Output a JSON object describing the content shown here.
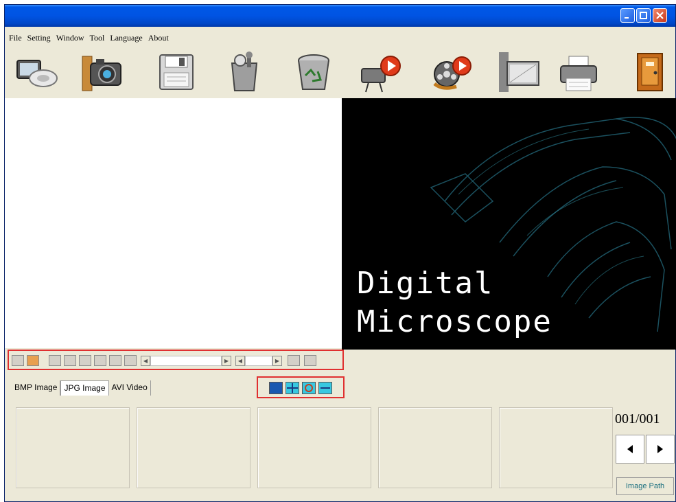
{
  "window": {
    "title": "",
    "controls": {
      "minimize": "minimize-icon",
      "maximize": "maximize-icon",
      "close": "close-icon"
    }
  },
  "menu": {
    "items": [
      "File",
      "Setting",
      "Window",
      "Tool",
      "Language",
      "About"
    ]
  },
  "toolbar": {
    "buttons": [
      {
        "name": "preview",
        "icon": "monitor-lens-icon"
      },
      {
        "name": "capture",
        "icon": "camera-icon"
      },
      {
        "name": "save",
        "icon": "floppy-disk-icon"
      },
      {
        "name": "settings",
        "icon": "tools-icon"
      },
      {
        "name": "delete",
        "icon": "recycle-bin-icon"
      },
      {
        "name": "record",
        "icon": "video-camera-record-icon"
      },
      {
        "name": "playback",
        "icon": "film-reel-play-icon"
      },
      {
        "name": "film",
        "icon": "film-strip-icon"
      },
      {
        "name": "print",
        "icon": "printer-icon"
      },
      {
        "name": "exit",
        "icon": "exit-door-icon"
      }
    ]
  },
  "splash": {
    "line1": "Digital",
    "line2": "Microscope"
  },
  "tabs": [
    "BMP Image",
    "JPG Image",
    "AVI Video"
  ],
  "active_tab": "JPG Image",
  "pager": {
    "counter": "001/001",
    "image_path_label": "Image Path"
  }
}
